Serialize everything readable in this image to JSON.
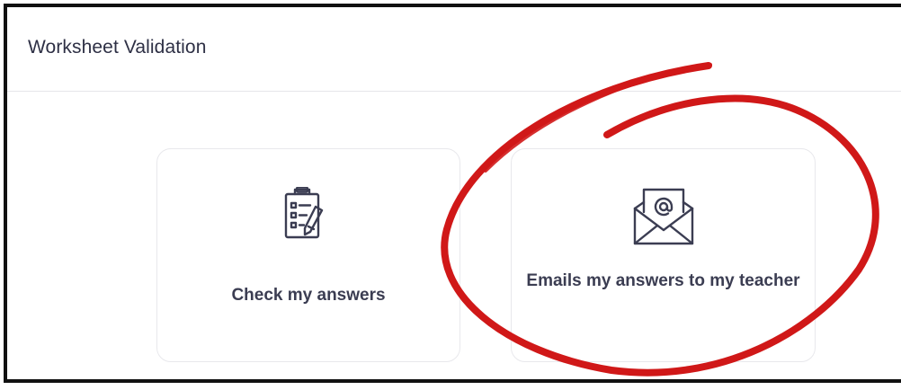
{
  "header": {
    "title": "Worksheet Validation"
  },
  "cards": {
    "check": {
      "label": "Check my answers",
      "icon": "clipboard-checklist-icon"
    },
    "email": {
      "label": "Emails my answers to my teacher",
      "icon": "envelope-at-icon"
    }
  },
  "colors": {
    "title_text": "#2e3045",
    "card_text": "#3b3d52",
    "card_border": "#e8e8ec",
    "annotation_red": "#d01818",
    "frame_border": "#111111"
  }
}
